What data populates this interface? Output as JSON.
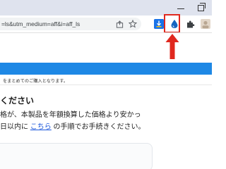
{
  "browser": {
    "url_text": "=ls&utm_medium=aff&i=aff_ls",
    "icons": {
      "share": "share-icon",
      "star": "star-icon",
      "download_extension": "download-extension-icon",
      "drop_extension": "water-drop-extension-icon",
      "puzzle": "puzzle-icon",
      "profile": "profile-icon"
    },
    "colors": {
      "highlight": "#e0281e",
      "drop": "#1565c0",
      "download_ext": "#1a73e8"
    }
  },
  "page": {
    "header_color": "#1e88e5",
    "notice": "をまとめてのご購入となります。",
    "heading": "ください",
    "line1": "格が、本製品を年額換算した価格より安かっ",
    "line2_before": "日以内に ",
    "line2_link": "こちら",
    "line2_after": " の手順でお手続きください。"
  }
}
